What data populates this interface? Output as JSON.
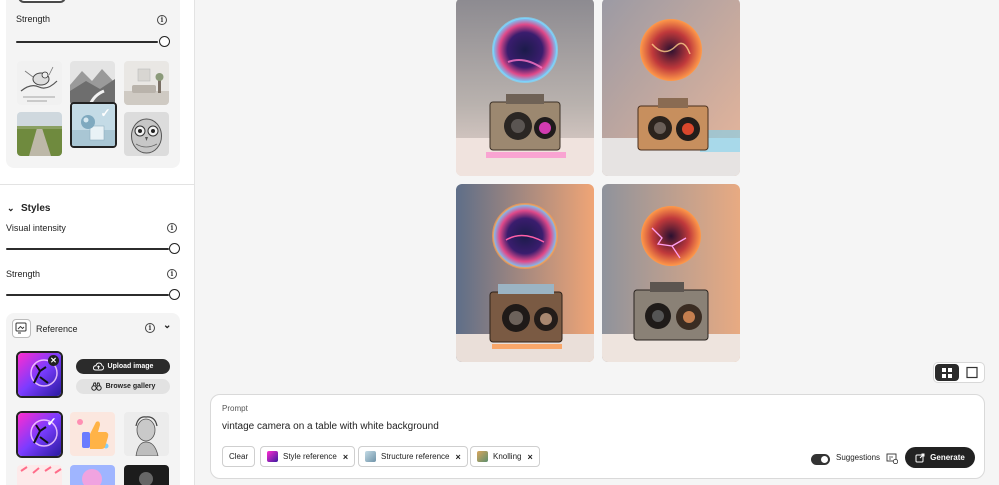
{
  "sidebar": {
    "structure": {
      "strength_label": "Strength",
      "strength_value": 1.0,
      "thumbnails": [
        {
          "name": "bird-sketch",
          "selected": false
        },
        {
          "name": "mountain-road",
          "selected": false
        },
        {
          "name": "living-room",
          "selected": false
        },
        {
          "name": "field-road",
          "selected": false
        },
        {
          "name": "sphere-cube-3d",
          "selected": true
        },
        {
          "name": "owl-sketch",
          "selected": false
        }
      ]
    },
    "styles": {
      "title": "Styles",
      "visual_intensity_label": "Visual intensity",
      "visual_intensity_value": 1.0,
      "strength_label": "Strength",
      "strength_value": 1.0
    },
    "reference": {
      "title": "Reference",
      "upload_label": "Upload image",
      "browse_label": "Browse gallery",
      "gallery": [
        {
          "name": "neon-figure",
          "selected": true
        },
        {
          "name": "thumbs-up-3d",
          "selected": false
        },
        {
          "name": "classical-bust",
          "selected": false
        }
      ]
    }
  },
  "main": {
    "images": [
      {
        "name": "camera-variation-1"
      },
      {
        "name": "camera-variation-2"
      },
      {
        "name": "camera-variation-3"
      },
      {
        "name": "camera-variation-4"
      }
    ],
    "view_mode": "grid"
  },
  "prompt": {
    "label": "Prompt",
    "text": "vintage camera on a table with white background",
    "clear_label": "Clear",
    "chips": [
      {
        "label": "Style reference"
      },
      {
        "label": "Structure reference"
      },
      {
        "label": "Knolling"
      }
    ],
    "suggestions_label": "Suggestions",
    "suggestions_on": true,
    "generate_label": "Generate"
  },
  "colors": {
    "accent_dark": "#222222",
    "panel_bg": "#f4f4f4",
    "canvas_bg": "#f5f5f5"
  }
}
